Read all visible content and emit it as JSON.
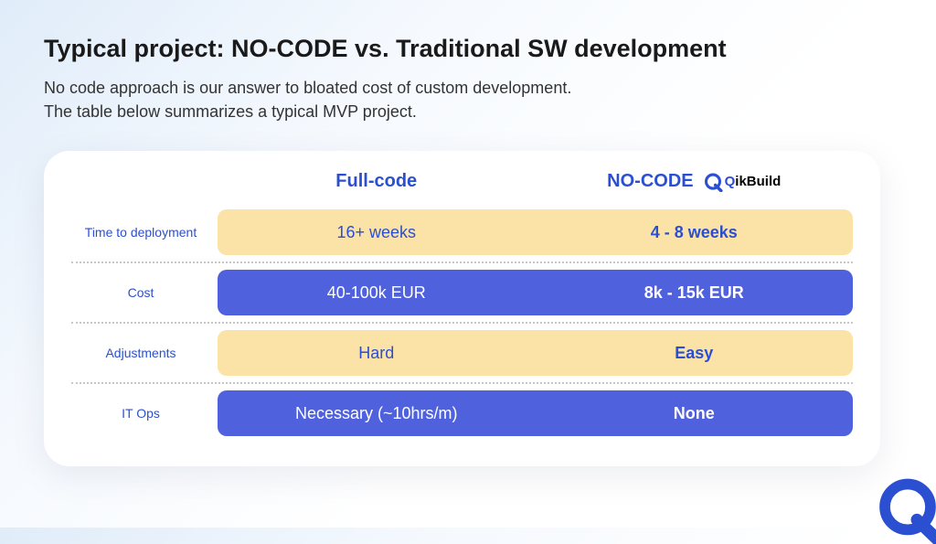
{
  "title": "Typical project: NO-CODE vs. Traditional SW development",
  "subtitle_line1": "No code approach is our answer to bloated cost of custom development.",
  "subtitle_line2": "The table below summarizes a typical MVP project.",
  "columns": {
    "left": "Full-code",
    "right": "NO-CODE"
  },
  "brand": {
    "q": "Q",
    "rest": "ikBuild"
  },
  "rows": [
    {
      "label": "Time to deployment",
      "left": "16+ weeks",
      "right": "4 - 8 weeks",
      "style": "yellow"
    },
    {
      "label": "Cost",
      "left": "40-100k EUR",
      "right": "8k - 15k EUR",
      "style": "blue"
    },
    {
      "label": "Adjustments",
      "left": "Hard",
      "right": "Easy",
      "style": "yellow"
    },
    {
      "label": "IT Ops",
      "left": "Necessary (~10hrs/m)",
      "right": "None",
      "style": "blue"
    }
  ],
  "colors": {
    "accent_blue": "#2b4fd1",
    "pill_yellow": "#fbe2a6",
    "pill_blue": "#4f61dd"
  }
}
